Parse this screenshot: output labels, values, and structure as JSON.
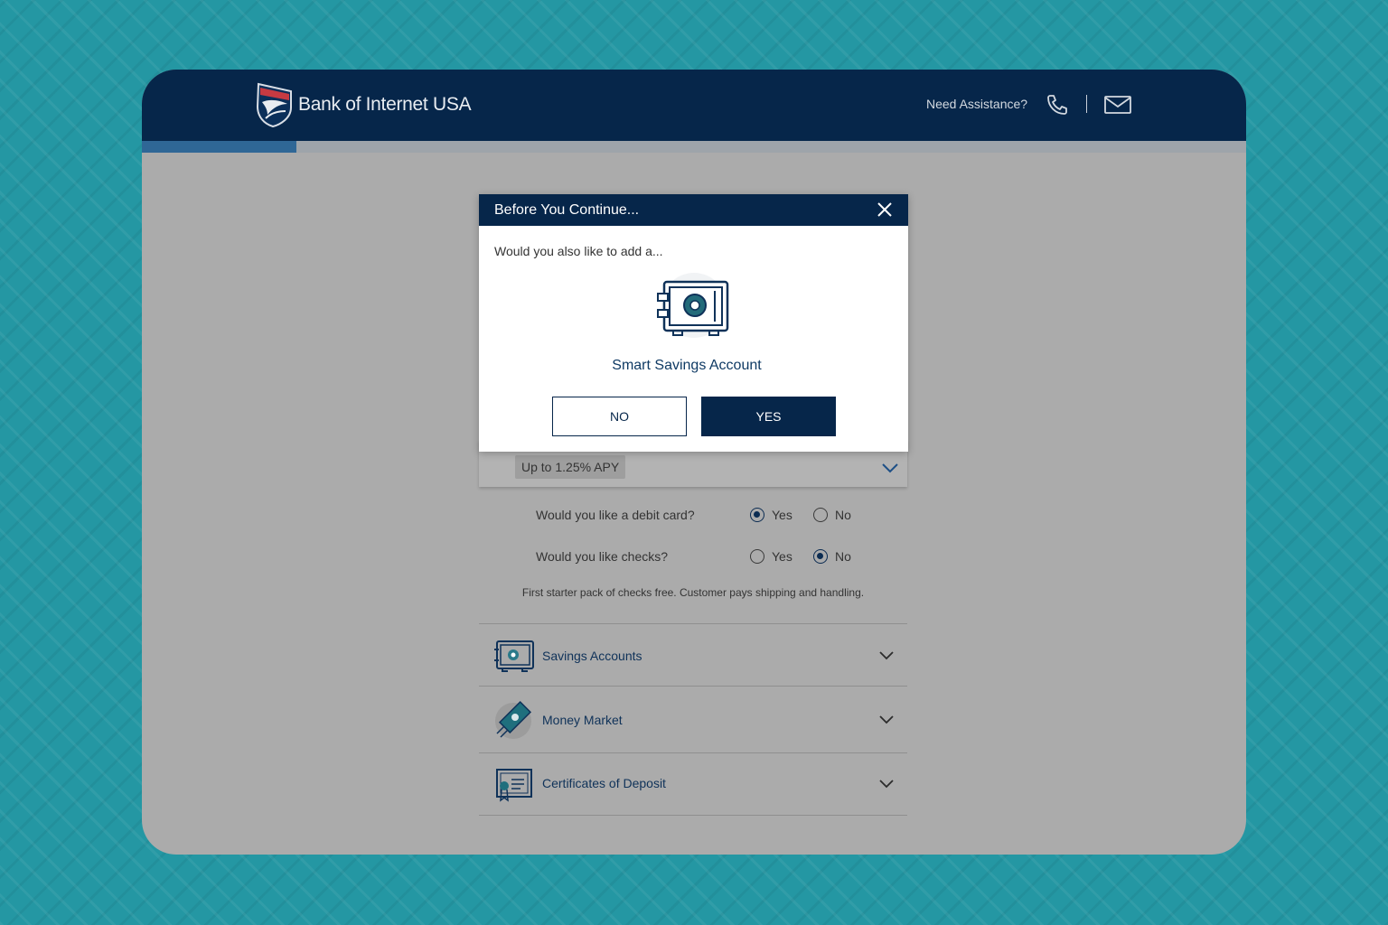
{
  "header": {
    "brand": "Bank of Internet USA",
    "assistance_label": "Need Assistance?",
    "icons": [
      "eagle-logo-icon",
      "phone-icon",
      "mail-icon"
    ],
    "colors": {
      "navy": "#06264a",
      "progress": "#2f6796"
    }
  },
  "progress": {
    "fraction": 0.14
  },
  "checking": {
    "apy_badge": "Up to 1.25% APY",
    "debit_question": "Would you like a debit card?",
    "checks_question": "Would you like checks?",
    "yes_label": "Yes",
    "no_label": "No",
    "debit_selected": "Yes",
    "checks_selected": "No",
    "checks_note": "First starter pack of checks free. Customer pays shipping and handling."
  },
  "accordion": [
    {
      "label": "Savings Accounts",
      "icon": "safe-icon"
    },
    {
      "label": "Money Market",
      "icon": "money-icon"
    },
    {
      "label": "Certificates of Deposit",
      "icon": "certificate-icon"
    }
  ],
  "modal": {
    "title": "Before You Continue...",
    "question": "Would you also like to add a...",
    "product": "Smart Savings Account",
    "no_label": "NO",
    "yes_label": "YES"
  }
}
